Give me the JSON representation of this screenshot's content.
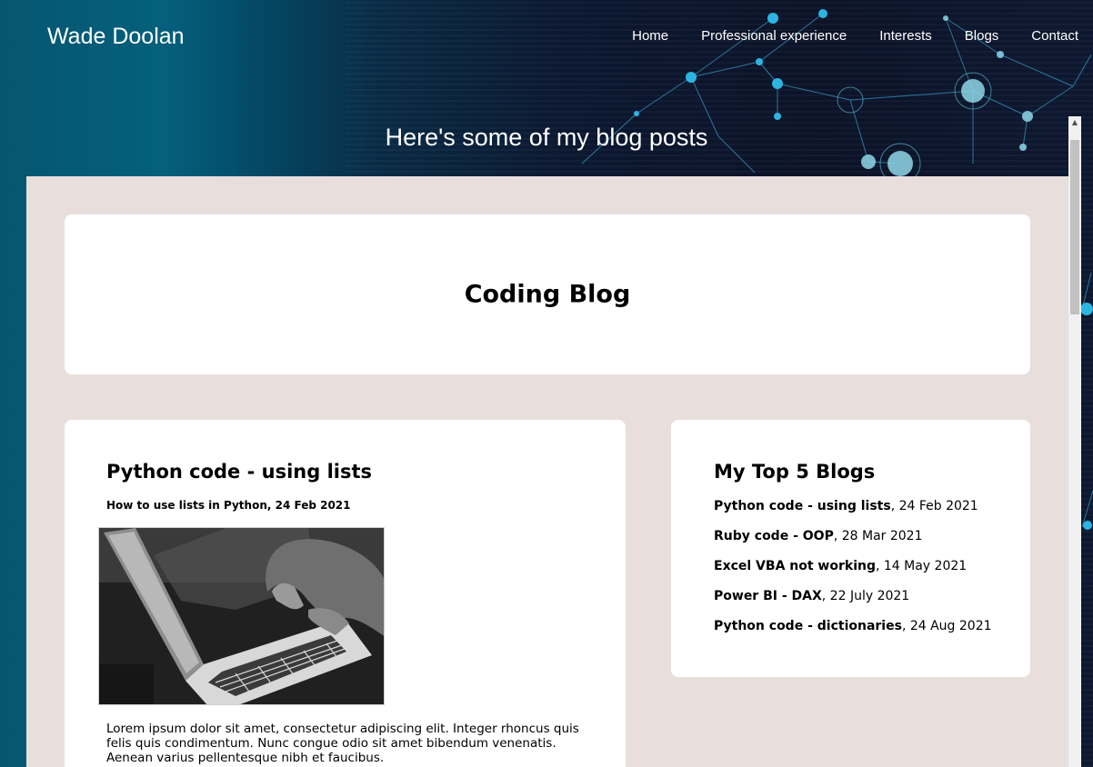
{
  "site": {
    "title": "Wade Doolan"
  },
  "nav": [
    "Home",
    "Professional experience",
    "Interests",
    "Blogs",
    "Contact"
  ],
  "hero": {
    "heading": "Here's some of my blog posts"
  },
  "title_card": {
    "heading": "Coding Blog"
  },
  "post": {
    "title": "Python code - using lists",
    "subtitle": "How to use lists in Python, 24 Feb 2021",
    "body": "Lorem ipsum dolor sit amet, consectetur adipiscing elit. Integer rhoncus quis felis quis condimentum. Nunc congue odio sit amet bibendum venenatis. Aenean varius pellentesque nibh et faucibus."
  },
  "top_blogs": {
    "heading": "My Top 5 Blogs",
    "items": [
      {
        "title": "Python code - using lists",
        "date": ", 24 Feb 2021"
      },
      {
        "title": "Ruby code - OOP",
        "date": ", 28 Mar 2021"
      },
      {
        "title": "Excel VBA not working",
        "date": ", 14 May 2021"
      },
      {
        "title": "Power BI - DAX",
        "date": ", 22 July 2021"
      },
      {
        "title": "Python code - dictionaries",
        "date": ", 24 Aug 2021"
      }
    ]
  },
  "colors": {
    "content_bg": "#e8dfdd",
    "card_bg": "#ffffff",
    "header_teal": "#04607c"
  }
}
